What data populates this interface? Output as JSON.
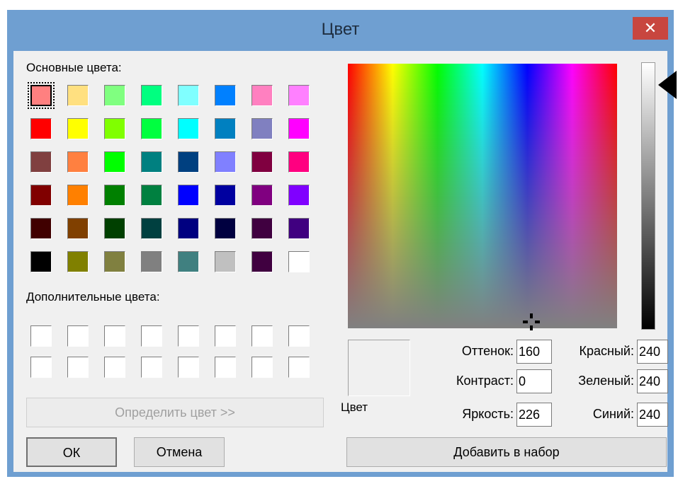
{
  "window": {
    "title": "Цвет",
    "close_label": "✕"
  },
  "basic_colors": {
    "label": "Основные цвета:",
    "rows": [
      [
        "#ff8080",
        "#ffe080",
        "#80ff80",
        "#00ff80",
        "#80ffff",
        "#0080ff",
        "#ff80c0",
        "#ff80ff"
      ],
      [
        "#ff0000",
        "#ffff00",
        "#80ff00",
        "#00ff40",
        "#00ffff",
        "#0080c0",
        "#8080c0",
        "#ff00ff"
      ],
      [
        "#804040",
        "#ff8040",
        "#00ff00",
        "#008080",
        "#004080",
        "#8080ff",
        "#800040",
        "#ff0080"
      ],
      [
        "#800000",
        "#ff8000",
        "#008000",
        "#008040",
        "#0000ff",
        "#0000a0",
        "#800080",
        "#8000ff"
      ],
      [
        "#400000",
        "#804000",
        "#004000",
        "#004040",
        "#000080",
        "#000040",
        "#400040",
        "#400080"
      ],
      [
        "#000000",
        "#808000",
        "#808040",
        "#808080",
        "#408080",
        "#c0c0c0",
        "#400040",
        "#ffffff"
      ]
    ]
  },
  "custom_colors": {
    "label": "Дополнительные цвета:"
  },
  "buttons": {
    "define": "Определить цвет >>",
    "ok": "ОК",
    "cancel": "Отмена",
    "add": "Добавить в набор"
  },
  "preview": {
    "label": "Цвет"
  },
  "fields": {
    "hue_label": "Оттенок:",
    "hue": "160",
    "sat_label": "Контраст:",
    "sat": "0",
    "lum_label": "Яркость:",
    "lum": "226",
    "red_label": "Красный:",
    "red": "240",
    "green_label": "Зеленый:",
    "green": "240",
    "blue_label": "Синий:",
    "blue": "240"
  },
  "colors": {
    "title_bar": "#6f9fd1",
    "close": "#c8463f",
    "dialog_bg": "#f0f0f0"
  },
  "icons": {
    "close": "close-icon",
    "luminance_pointer": "triangle-left-icon",
    "crosshair": "crosshair-icon"
  }
}
